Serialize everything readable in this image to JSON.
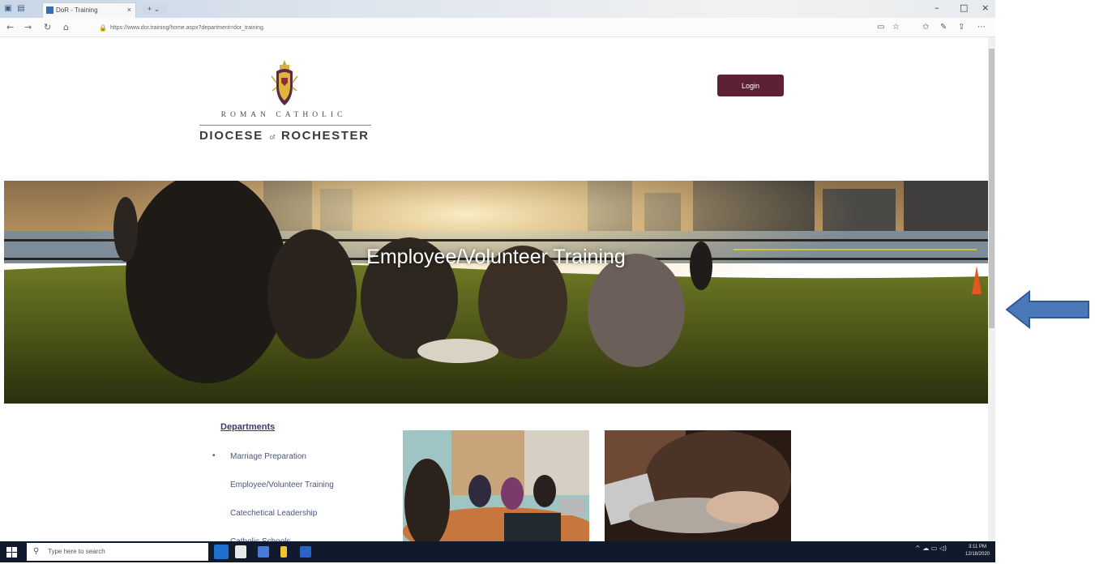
{
  "browser": {
    "tab_title": "DoR - Training",
    "tab_close": "×",
    "url": "https://www.dor.training/home.aspx?department=dor_training",
    "window_controls": {
      "minimize": "–",
      "maximize": "□",
      "close": "×"
    }
  },
  "header": {
    "logo_line1": "ROMAN CATHOLIC",
    "logo_line2_a": "DIOCESE",
    "logo_line2_of": "of",
    "logo_line2_b": "ROCHESTER",
    "login_label": "Login"
  },
  "hero": {
    "title": "Employee/Volunteer Training"
  },
  "departments": {
    "heading": "Departments",
    "items": [
      {
        "label": "Marriage Preparation"
      },
      {
        "label": "Employee/Volunteer Training"
      },
      {
        "label": "Catechetical Leadership"
      },
      {
        "label": "Catholic Schools"
      }
    ]
  },
  "taskbar": {
    "search_placeholder": "Type here to search",
    "clock_time": "3:11 PM",
    "clock_date": "12/18/2020"
  },
  "colors": {
    "login_bg": "#5c2233",
    "taskbar_bg": "#101a2c",
    "link_color": "#4c567e",
    "arrow_fill": "#4a78b8"
  },
  "icons": {
    "back": "arrow-left-icon",
    "forward": "arrow-right-icon",
    "refresh": "refresh-icon",
    "home": "home-icon",
    "star": "star-icon",
    "favorites": "favorites-icon",
    "share": "share-icon",
    "more": "more-icon",
    "search": "search-icon"
  }
}
